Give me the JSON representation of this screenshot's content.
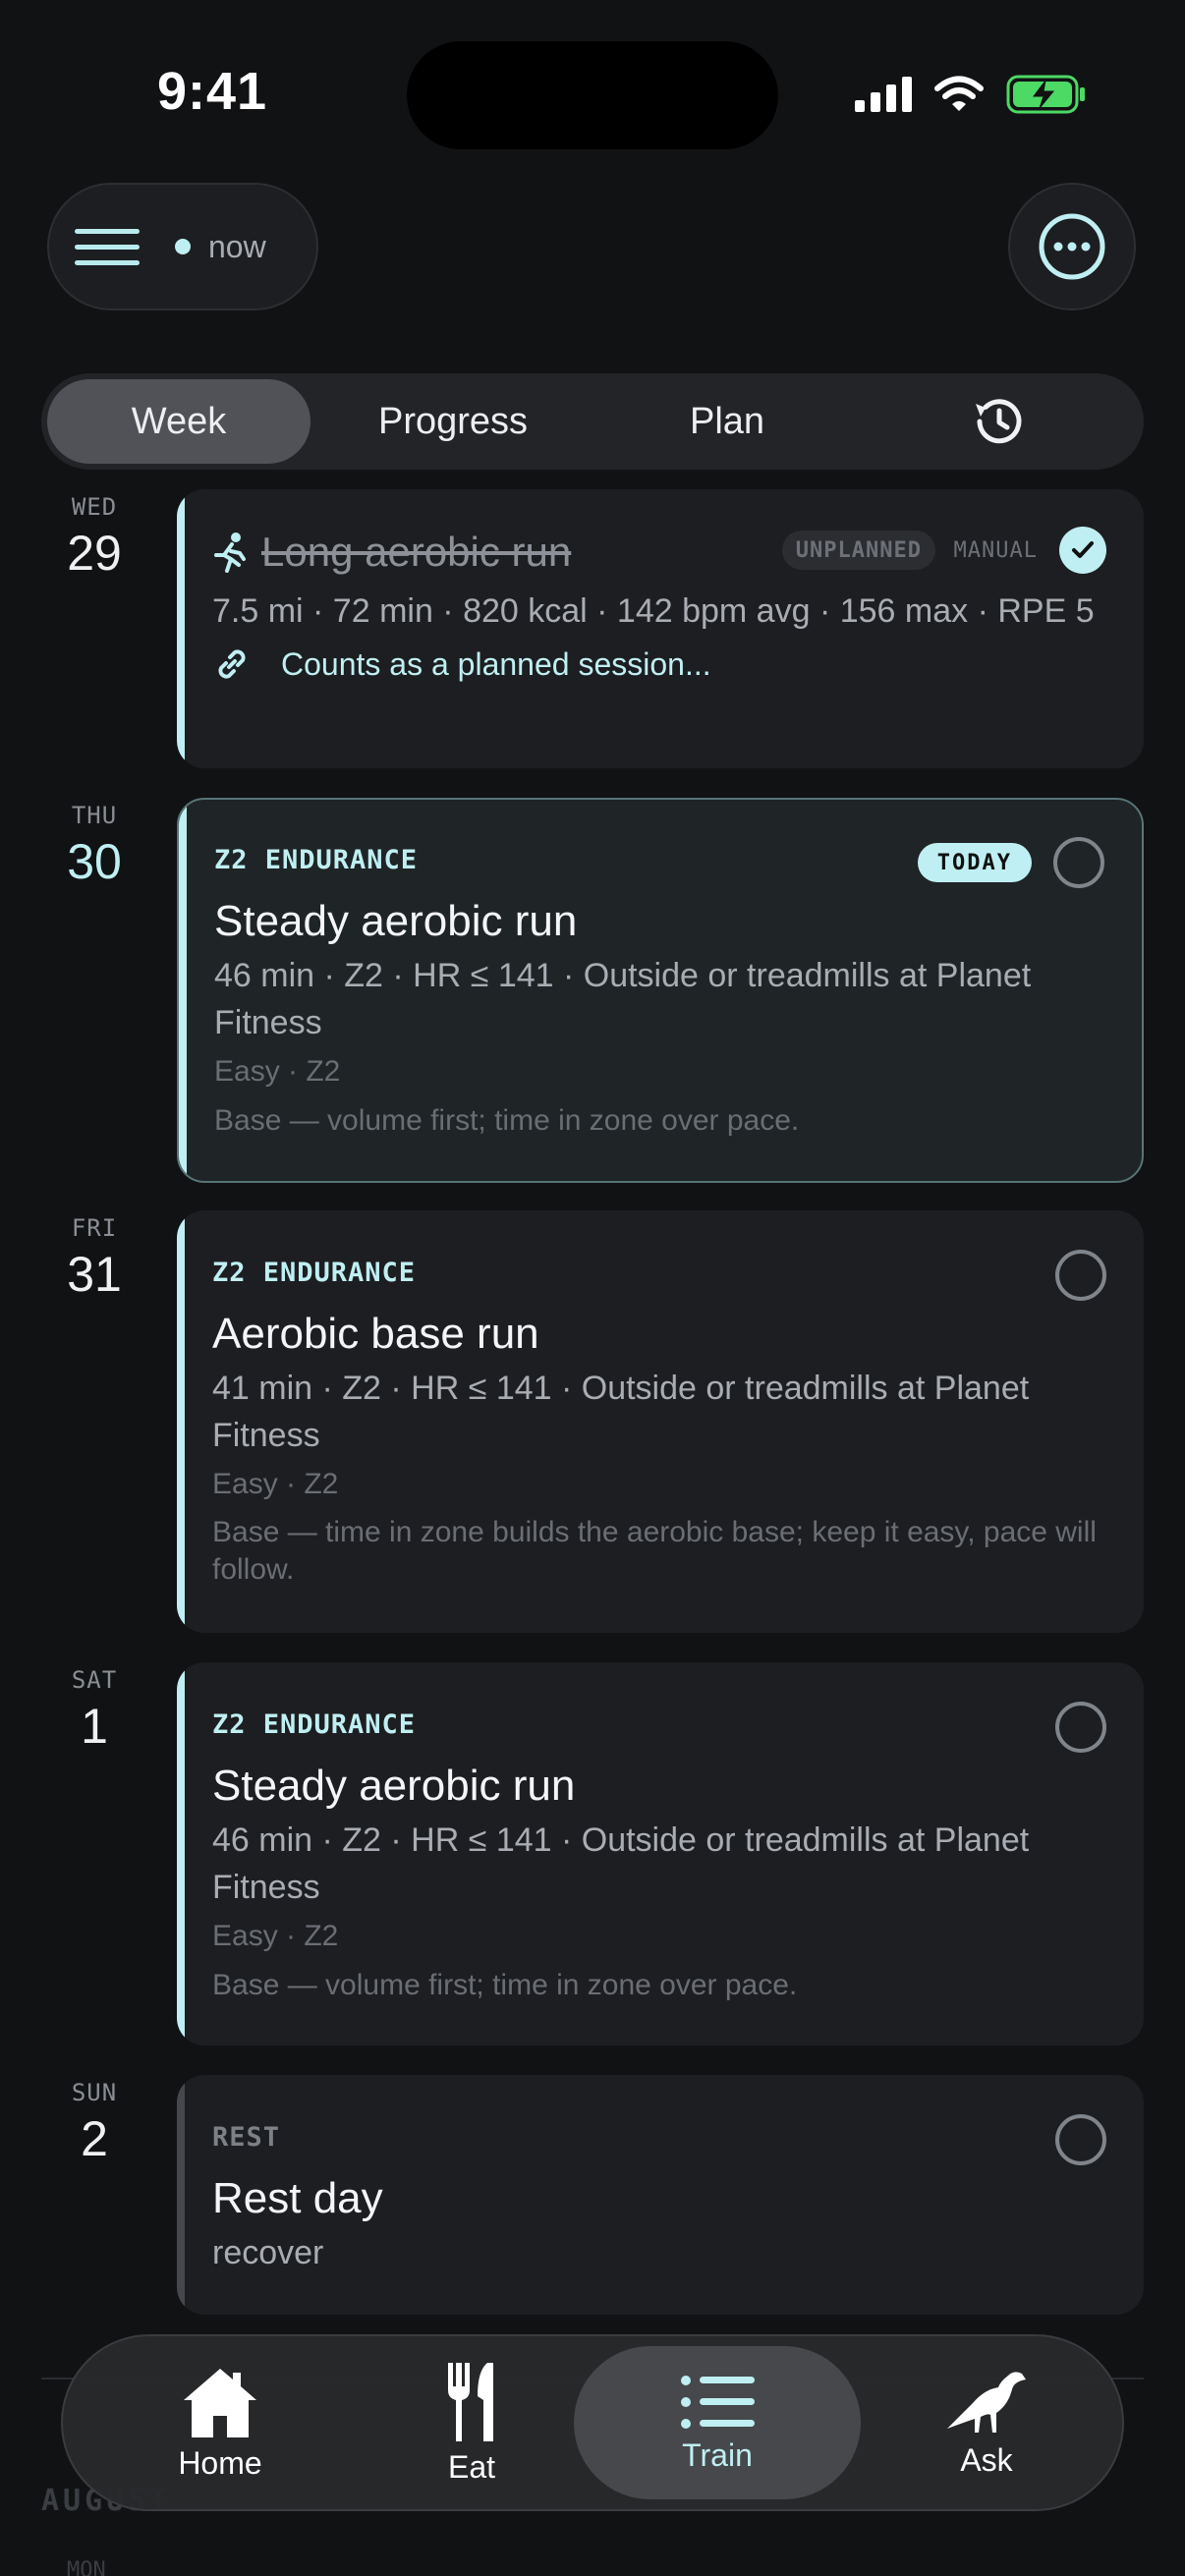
{
  "status_bar": {
    "time": "9:41"
  },
  "header": {
    "now_label": "now"
  },
  "segments": [
    {
      "label": "Week",
      "active": true
    },
    {
      "label": "Progress",
      "active": false
    },
    {
      "label": "Plan",
      "active": false
    }
  ],
  "history_icon": "history-clock-icon",
  "days": [
    {
      "dow": "WED",
      "date": "29",
      "title": "Long aerobic run",
      "badge": "UNPLANNED",
      "source": "MANUAL",
      "stats": "7.5 mi · 72 min · 820 kcal · 142 bpm avg · 156 max · RPE 5",
      "link_text": "Counts as a planned session...",
      "completed": true
    },
    {
      "dow": "THU",
      "date": "30",
      "tag": "Z2 ENDURANCE",
      "badge": "TODAY",
      "title": "Steady aerobic run",
      "detail": "46 min · Z2 · HR ≤ 141 · Outside or treadmills at Planet Fitness",
      "intensity": "Easy · Z2",
      "note": "Base — volume first; time in zone over pace."
    },
    {
      "dow": "FRI",
      "date": "31",
      "tag": "Z2 ENDURANCE",
      "title": "Aerobic base run",
      "detail": "41 min · Z2 · HR ≤ 141 · Outside or treadmills at Planet Fitness",
      "intensity": "Easy · Z2",
      "note": "Base — time in zone builds the aerobic base; keep it easy, pace will follow."
    },
    {
      "dow": "SAT",
      "date": "1",
      "tag": "Z2 ENDURANCE",
      "title": "Steady aerobic run",
      "detail": "46 min · Z2 · HR ≤ 141 · Outside or treadmills at Planet Fitness",
      "intensity": "Easy · Z2",
      "note": "Base — volume first; time in zone over pace."
    },
    {
      "dow": "SUN",
      "date": "2",
      "tag": "REST",
      "title": "Rest day",
      "detail": "recover"
    }
  ],
  "below": {
    "month": "AUGUST",
    "next_dow": "MON"
  },
  "tabs": [
    {
      "label": "Home",
      "icon": "house-icon"
    },
    {
      "label": "Eat",
      "icon": "fork-knife-icon"
    },
    {
      "label": "Train",
      "icon": "list-icon",
      "active": true
    },
    {
      "label": "Ask",
      "icon": "bird-icon"
    }
  ],
  "colors": {
    "accent": "#bfeff2",
    "background": "#111214",
    "card": "#1d1e21"
  }
}
